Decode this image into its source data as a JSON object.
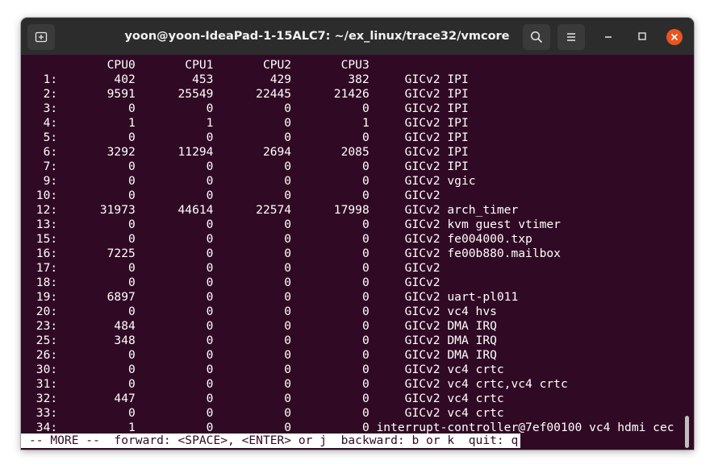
{
  "window": {
    "title": "yoon@yoon-IdeaPad-1-15ALC7: ~/ex_linux/trace32/vmcore"
  },
  "icons": {
    "new_tab": "new-tab-icon",
    "search": "search-icon",
    "menu": "hamburger-menu-icon",
    "minimize": "minimize-icon",
    "maximize": "maximize-icon",
    "close": "close-icon"
  },
  "colors": {
    "terminal_bg": "#300a24",
    "titlebar_bg": "#2c2c2c",
    "close_button": "#e95420",
    "text": "#ffffff"
  },
  "terminal": {
    "lines": [
      "           CPU0       CPU1       CPU2       CPU3",
      "  1:        402        453        429        382     GICv2 IPI",
      "  2:       9591      25549      22445      21426     GICv2 IPI",
      "  3:          0          0          0          0     GICv2 IPI",
      "  4:          1          1          0          1     GICv2 IPI",
      "  5:          0          0          0          0     GICv2 IPI",
      "  6:       3292      11294       2694       2085     GICv2 IPI",
      "  7:          0          0          0          0     GICv2 IPI",
      "  9:          0          0          0          0     GICv2 vgic",
      " 10:          0          0          0          0     GICv2",
      " 12:      31973      44614      22574      17998     GICv2 arch_timer",
      " 13:          0          0          0          0     GICv2 kvm guest vtimer",
      " 15:          0          0          0          0     GICv2 fe004000.txp",
      " 16:       7225          0          0          0     GICv2 fe00b880.mailbox",
      " 17:          0          0          0          0     GICv2",
      " 18:          0          0          0          0     GICv2",
      " 19:       6897          0          0          0     GICv2 uart-pl011",
      " 20:          0          0          0          0     GICv2 vc4 hvs",
      " 23:        484          0          0          0     GICv2 DMA IRQ",
      " 25:        348          0          0          0     GICv2 DMA IRQ",
      " 26:          0          0          0          0     GICv2 DMA IRQ",
      " 30:          0          0          0          0     GICv2 vc4 crtc",
      " 31:          0          0          0          0     GICv2 vc4 crtc,vc4 crtc",
      " 32:        447          0          0          0     GICv2 vc4 crtc",
      " 33:          0          0          0          0     GICv2 vc4 crtc",
      " 34:          1          0          0          0 interrupt-controller@7ef00100 vc4 hdmi cec"
    ],
    "pager_prompt": "-- MORE --  forward: <SPACE>, <ENTER> or j  backward: b or k  quit: q"
  }
}
